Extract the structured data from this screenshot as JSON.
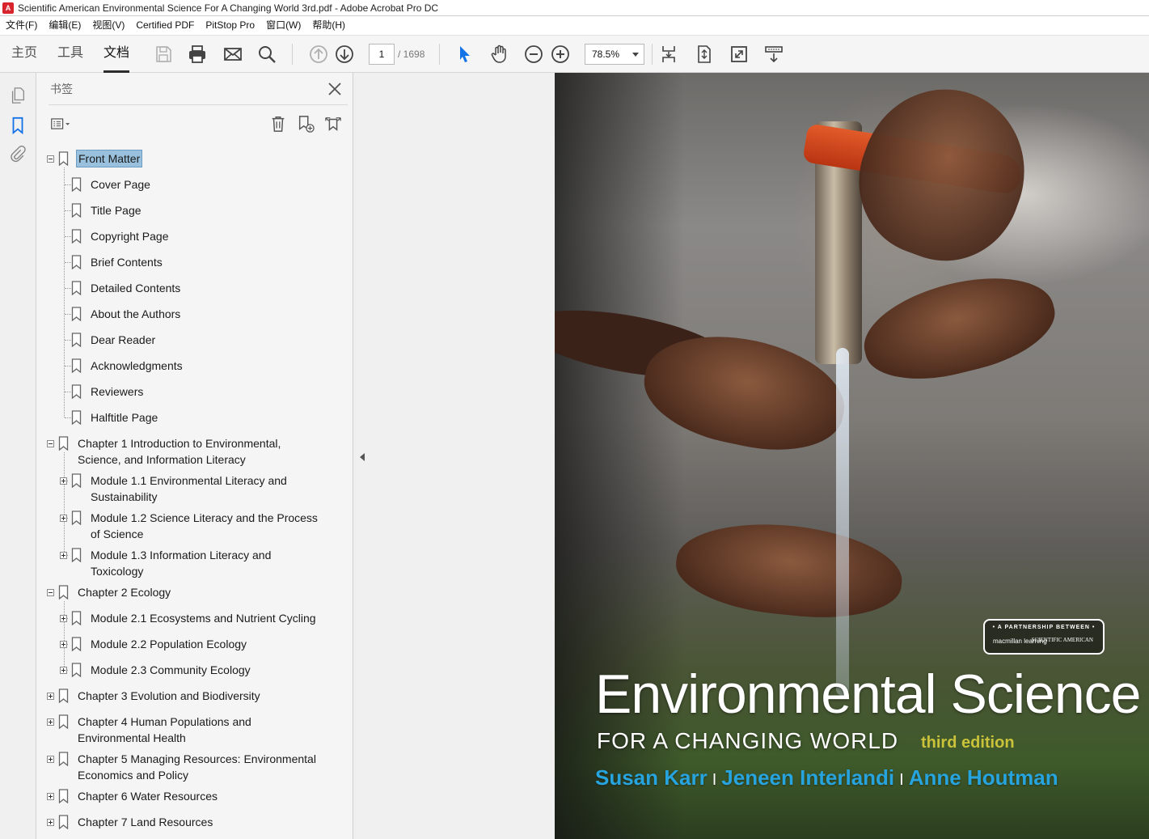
{
  "window": {
    "title": "Scientific American Environmental Science For A Changing World 3rd.pdf - Adobe Acrobat Pro DC"
  },
  "menubar": {
    "items": [
      "文件(F)",
      "编辑(E)",
      "视图(V)",
      "Certified PDF",
      "PitStop Pro",
      "窗口(W)",
      "帮助(H)"
    ]
  },
  "toolbar": {
    "tabs": [
      "主页",
      "工具",
      "文档"
    ],
    "active_tab": "文档",
    "page_current": "1",
    "page_total": "/ 1698",
    "zoom": "78.5%"
  },
  "bookmarks": {
    "title": "书签",
    "items": [
      {
        "label": "Front Matter",
        "level": 0,
        "toggle": "minus",
        "selected": true
      },
      {
        "label": "Cover Page",
        "level": 1
      },
      {
        "label": "Title Page",
        "level": 1
      },
      {
        "label": "Copyright Page",
        "level": 1
      },
      {
        "label": "Brief Contents",
        "level": 1
      },
      {
        "label": "Detailed Contents",
        "level": 1
      },
      {
        "label": "About the Authors",
        "level": 1
      },
      {
        "label": "Dear Reader",
        "level": 1
      },
      {
        "label": "Acknowledgments",
        "level": 1
      },
      {
        "label": "Reviewers",
        "level": 1
      },
      {
        "label": "Halftitle Page",
        "level": 1
      },
      {
        "label": "Chapter 1 Introduction to Environmental,",
        "label2": "Science, and Information Literacy",
        "level": 0,
        "toggle": "minus"
      },
      {
        "label": "Module 1.1 Environmental Literacy and",
        "label2": "Sustainability",
        "level": 1,
        "toggle": "plus"
      },
      {
        "label": "Module 1.2 Science Literacy and the Process",
        "label2": "of Science",
        "level": 1,
        "toggle": "plus"
      },
      {
        "label": "Module 1.3 Information Literacy and",
        "label2": "Toxicology",
        "level": 1,
        "toggle": "plus"
      },
      {
        "label": "Chapter 2 Ecology",
        "level": 0,
        "toggle": "minus"
      },
      {
        "label": "Module 2.1 Ecosystems and Nutrient Cycling",
        "level": 1,
        "toggle": "plus"
      },
      {
        "label": "Module 2.2 Population Ecology",
        "level": 1,
        "toggle": "plus"
      },
      {
        "label": "Module 2.3 Community Ecology",
        "level": 1,
        "toggle": "plus"
      },
      {
        "label": "Chapter 3 Evolution and Biodiversity",
        "level": 0,
        "toggle": "plus"
      },
      {
        "label": "Chapter 4 Human Populations and",
        "label2": "Environmental Health",
        "level": 0,
        "toggle": "plus"
      },
      {
        "label": "Chapter 5 Managing Resources: Environmental",
        "label2": "Economics and Policy",
        "level": 0,
        "toggle": "plus"
      },
      {
        "label": "Chapter 6 Water Resources",
        "level": 0,
        "toggle": "plus"
      },
      {
        "label": "Chapter 7 Land Resources",
        "level": 0,
        "toggle": "plus"
      }
    ]
  },
  "cover": {
    "badge_top": "• A PARTNERSHIP BETWEEN •",
    "badge_left": "macmillan learning",
    "badge_right": "SCIENTIFIC AMERICAN",
    "title": "Environmental Science",
    "subtitle": "FOR A CHANGING WORLD",
    "edition": "third edition",
    "authors": [
      "Susan Karr",
      "Jeneen Interlandi",
      "Anne Houtman"
    ],
    "author_separator": "I"
  },
  "colors": {
    "selection": "#99c1de",
    "author_blue": "#27a4de",
    "edition_yellow": "#c9c23a",
    "acrobat_red": "#d8242d",
    "cursor_blue": "#1473e6"
  }
}
